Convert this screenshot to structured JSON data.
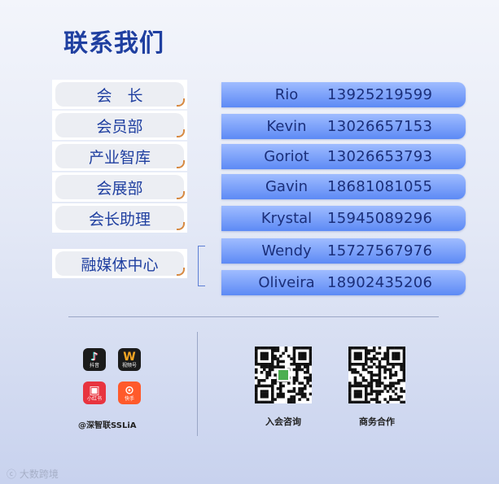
{
  "title": "联系我们",
  "departments": [
    {
      "label": "会　长"
    },
    {
      "label": "会员部"
    },
    {
      "label": "产业智库"
    },
    {
      "label": "会展部"
    },
    {
      "label": "会长助理"
    },
    {
      "label": "融媒体中心"
    }
  ],
  "contacts": [
    {
      "name": "Rio",
      "phone": "13925219599"
    },
    {
      "name": "Kevin",
      "phone": "13026657153"
    },
    {
      "name": "Goriot",
      "phone": "13026653793"
    },
    {
      "name": "Gavin",
      "phone": "18681081055"
    },
    {
      "name": "Krystal",
      "phone": "15945089296"
    },
    {
      "name": "Wendy",
      "phone": "15727567976"
    },
    {
      "name": "Oliveira",
      "phone": "18902435206"
    }
  ],
  "social": {
    "apps": [
      {
        "icon": "douyin-icon",
        "label": "抖音",
        "color": "#1b1b1b"
      },
      {
        "icon": "channels-icon",
        "label": "视频号",
        "color": "#1b1b1b"
      },
      {
        "icon": "xiaohongshu-icon",
        "label": "小红书",
        "color": "#e8343f"
      },
      {
        "icon": "kuaishou-icon",
        "label": "快手",
        "color": "#ff5a2b"
      }
    ],
    "handle": "@深智联SSLiA"
  },
  "qr_codes": [
    {
      "label": "入会咨询"
    },
    {
      "label": "商务合作"
    }
  ],
  "watermark": "大数跨境",
  "colors": {
    "title": "#1f3fa0",
    "contact_bar": "#5d8af5",
    "dept_curl": "#d78a43"
  }
}
